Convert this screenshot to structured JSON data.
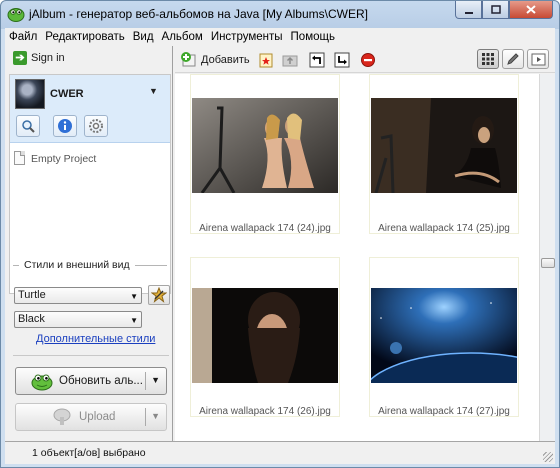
{
  "window": {
    "title": "jAlbum - генератор веб-альбомов на Java [My Albums\\CWER]"
  },
  "menu": [
    "Файл",
    "Редактировать",
    "Вид",
    "Альбом",
    "Инструменты",
    "Помощь"
  ],
  "sidebar": {
    "sign_in": "Sign in",
    "project_name": "CWER",
    "empty_project": "Empty Project",
    "styles_heading": "Стили и внешний вид",
    "skin_value": "Turtle",
    "style_value": "Black",
    "more_styles_link": "Дополнительные стили",
    "update_button": "Обновить аль...",
    "upload_button": "Upload"
  },
  "toolbar": {
    "add_label": "Добавить"
  },
  "gallery": {
    "items": [
      {
        "filename": "Airena wallapack 174 (24).jpg"
      },
      {
        "filename": "Airena wallapack 174 (25).jpg"
      },
      {
        "filename": "Airena wallapack 174 (26).jpg"
      },
      {
        "filename": "Airena wallapack 174 (27).jpg"
      }
    ]
  },
  "status": {
    "text": "1 объект[а/ов] выбрано"
  },
  "colors": {
    "accent": "#3a9a2c",
    "link": "#1a3fbf",
    "selection": "#dcebfa"
  }
}
